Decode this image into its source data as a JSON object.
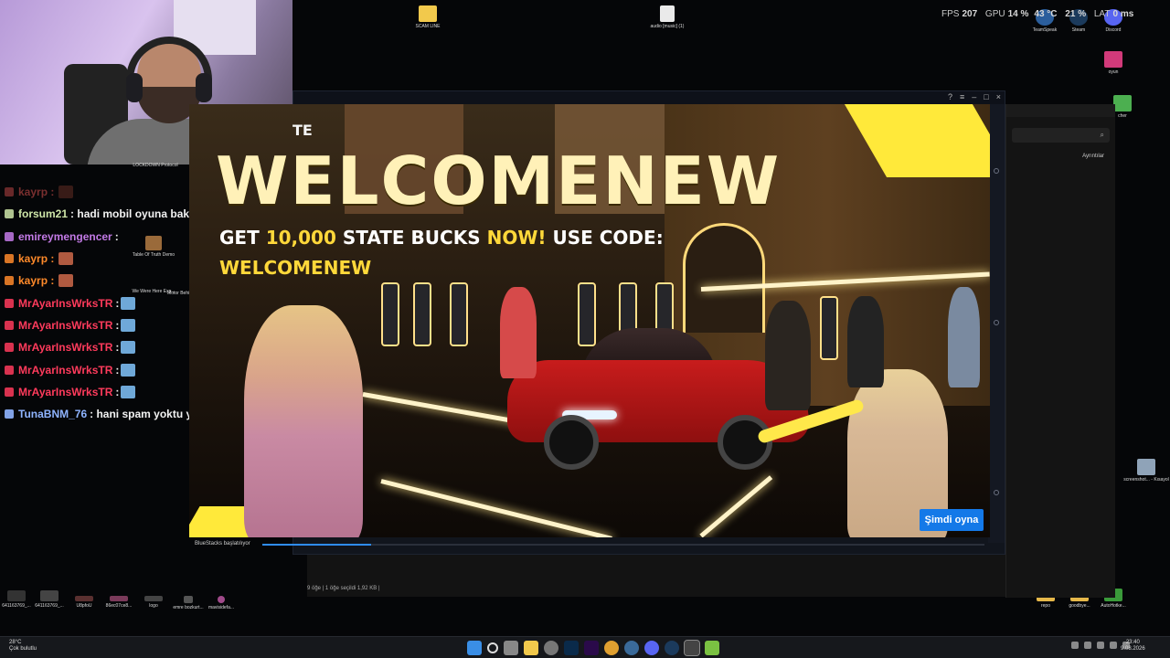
{
  "perf": {
    "fps_label": "FPS",
    "fps": "207",
    "gpu_label": "GPU",
    "gpu": "14 %",
    "gpu_temp": "43 °C",
    "cpu_pct": "21 %",
    "lat_label": "LAT",
    "lat": "0 ms"
  },
  "desktop": {
    "top_icons": [
      {
        "label": "SCAM LINE"
      },
      {
        "label": "audio [music] (1)"
      },
      {
        "label": "TeamSpeak"
      },
      {
        "label": "Steam"
      },
      {
        "label": "Discord"
      }
    ],
    "right_icons": [
      {
        "label": "oyun"
      },
      {
        "label": "cher"
      },
      {
        "label": "screenshot... - Kısayol"
      },
      {
        "label": "repo"
      },
      {
        "label": "goodbye..."
      },
      {
        "label": "AutoHotke..."
      }
    ],
    "left_icons": [
      {
        "label": "LOCKDOWN Protocol"
      },
      {
        "label": "Table Of Truth Demo"
      },
      {
        "label": "We Were Here Exp..."
      },
      {
        "label": "Motor Behind..."
      }
    ],
    "bottom_icons": [
      {
        "label": "641163769_..."
      },
      {
        "label": "641163769_..."
      },
      {
        "label": "U8pfoU"
      },
      {
        "label": "86ec07ce8..."
      },
      {
        "label": "logo"
      },
      {
        "label": "emre bozkurt..."
      },
      {
        "label": "mavisidefa..."
      }
    ]
  },
  "chat": [
    {
      "user": "kayrp :",
      "msg": "",
      "color": "#7a2f2f",
      "emotes": [
        "dim"
      ]
    },
    {
      "user": "forsum21",
      "msg": ": hadi mobil oyuna bak",
      "color": "#cfe6a8",
      "emotes": []
    },
    {
      "user": "emireymengencer",
      "msg": ":",
      "color": "#c37ae6",
      "emotes": []
    },
    {
      "user": "kayrp :",
      "msg": "",
      "color": "#ff8a2a",
      "emotes": [
        "red"
      ]
    },
    {
      "user": "kayrp :",
      "msg": "",
      "color": "#ff8a2a",
      "emotes": [
        "red"
      ]
    },
    {
      "user": "MrAyarInsWrksTR",
      "msg": ":",
      "color": "#ff3b5c",
      "emotes": [
        "blue"
      ]
    },
    {
      "user": "MrAyarInsWrksTR",
      "msg": ":",
      "color": "#ff3b5c",
      "emotes": [
        "blue"
      ]
    },
    {
      "user": "MrAyarInsWrksTR",
      "msg": ":",
      "color": "#ff3b5c",
      "emotes": [
        "blue"
      ]
    },
    {
      "user": "MrAyarInsWrksTR",
      "msg": ":",
      "color": "#ff3b5c",
      "emotes": [
        "blue"
      ]
    },
    {
      "user": "MrAyarInsWrksTR",
      "msg": ":",
      "color": "#ff3b5c",
      "emotes": [
        "blue"
      ]
    },
    {
      "user": "TunaBNM_76",
      "msg": ": hani spam yoktu ya",
      "color": "#8fb4ff",
      "emotes": []
    }
  ],
  "game": {
    "state_text": "TE",
    "headline": "WELCOMENEW",
    "promo_get": "GET",
    "promo_amount": "10,000",
    "promo_mid": "STATE BUCKS",
    "promo_now": "NOW!",
    "promo_use": "USE CODE:",
    "promo_code": "WELCOMENEW",
    "play_button": "Şimdi oyna"
  },
  "loader": {
    "text": "BlueStacks başlatılıyor",
    "progress": 0.15
  },
  "explorer": {
    "details": "Ayrıntılar",
    "status": "9 öğe  |  1 öğe seçildi  1,92 KB  |"
  },
  "taskbar": {
    "weather_temp": "28°C",
    "weather_desc": "Çok bulutlu",
    "time": "23:40",
    "date": "9.08.2026"
  },
  "colors": {
    "accent": "#1479e8",
    "promo_yellow": "#ffd83a",
    "loader": "#2f8cf5"
  }
}
